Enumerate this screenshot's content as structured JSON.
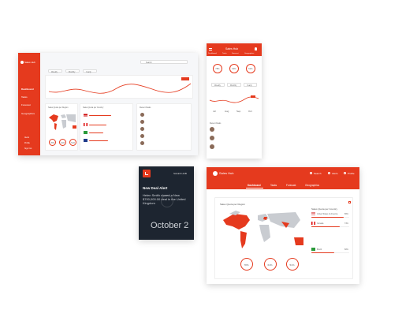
{
  "desktop": {
    "brand": "Sales Hub",
    "nav": [
      "Dashboard",
      "Tasks",
      "Forecast",
      "Geographics"
    ],
    "bottom_nav": [
      "Alerts",
      "Profile",
      "Sign Out"
    ],
    "search_placeholder": "Search",
    "tabs": [
      "Weekly",
      "Monthly",
      "Yearly"
    ],
    "map_title": "Sales Quota per Region",
    "country_title": "Sales Quota per Country",
    "deals_title": "Recent Deals",
    "gauges": [
      "78%",
      "64%",
      "51%"
    ]
  },
  "mobile": {
    "brand": "Sales Hub",
    "tabs": [
      "Dashboard",
      "Tasks",
      "Forecast",
      "Geographics"
    ],
    "gauges": [
      "78%",
      "64%",
      "51%"
    ],
    "segments": [
      "Weekly",
      "Monthly",
      "Yearly"
    ],
    "months": [
      "Jul",
      "Aug",
      "Sep",
      "Oct"
    ],
    "deals_title": "Recent Deals"
  },
  "watch": {
    "app": "SALES HUB",
    "alert_title": "New Deal Alert",
    "alert_body": "Helen Smith closed a New $700,000.00 deal in the United Kingdom",
    "date": "October 2"
  },
  "tablet": {
    "brand": "Sales Hub",
    "actions": [
      "Search",
      "Alerts",
      "Profile"
    ],
    "tabs": [
      "Dashboard",
      "Tasks",
      "Forecast",
      "Geographics"
    ],
    "map_title": "Sales Quota per Region",
    "country_title": "Sales Quota per Country",
    "gauges": [
      "78%",
      "64%",
      "51%"
    ],
    "countries": [
      {
        "name": "United States of America",
        "value": "86%",
        "fill": 0.86,
        "flag": "us-flag-icon"
      },
      {
        "name": "Canada",
        "value": "74%",
        "fill": 0.74,
        "flag": "ca-flag-icon"
      },
      {
        "name": "Brazil",
        "value": "60%",
        "fill": 0.6,
        "flag": "br-flag-icon"
      }
    ]
  },
  "colors": {
    "accent": "#e53a1e",
    "dark_watch": "#1d2530",
    "map_grey": "#c9ccd1"
  }
}
